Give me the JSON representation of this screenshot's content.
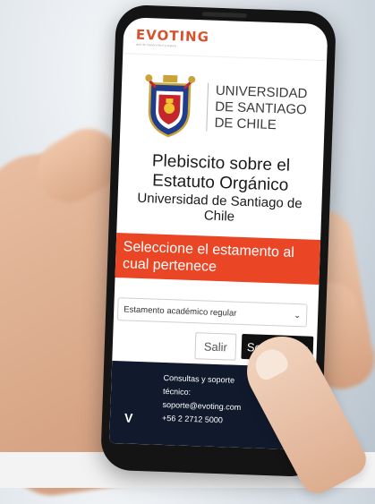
{
  "app": {
    "brand": "EVOTING",
    "brand_tagline": "Vote de manera fácil y segura"
  },
  "university": {
    "line1": "UNIVERSIDAD",
    "line2": "DE SANTIAGO",
    "line3": "DE CHILE"
  },
  "headline": {
    "line1": "Plebiscito sobre el",
    "line2": "Estatuto Orgánico",
    "line3": "Universidad de Santiago de",
    "line4": "Chile"
  },
  "banner": {
    "line1": "Seleccione el estamento al",
    "line2": "cual pertenece"
  },
  "form": {
    "selected_estamento": "Estamento académico regular",
    "cancel_label": "Salir",
    "submit_label": "Seleccionar"
  },
  "footer": {
    "line1": "Consultas y soporte",
    "line2": "técnico:",
    "email": "soporte@evoting.com",
    "phone": "+56 2 2712 5000",
    "logo_glyph": "V"
  },
  "colors": {
    "brand": "#d8512e",
    "banner": "#ea4524",
    "footer": "#111a2c",
    "button_dark": "#111111"
  }
}
